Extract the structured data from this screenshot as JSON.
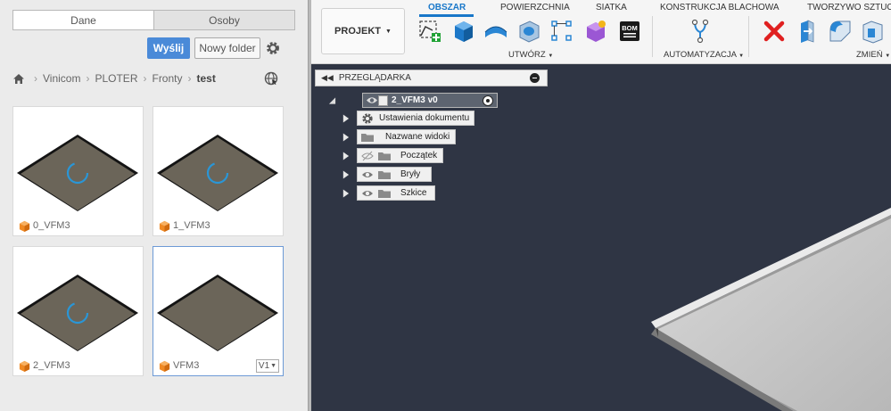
{
  "data_panel": {
    "tabs": [
      {
        "label": "Dane",
        "active": true
      },
      {
        "label": "Osoby",
        "active": false
      }
    ],
    "upload_label": "Wyślij",
    "new_folder_label": "Nowy folder",
    "breadcrumb": [
      "Vinicom",
      "PLOTER",
      "Fronty",
      "test"
    ],
    "cards": [
      {
        "name": "0_VFM3",
        "loading": true
      },
      {
        "name": "1_VFM3",
        "loading": true
      },
      {
        "name": "2_VFM3",
        "loading": true
      },
      {
        "name": "VFM3",
        "loading": false,
        "version": "V1",
        "selected": true
      }
    ]
  },
  "toolbar": {
    "project_label": "PROJEKT",
    "tabs": [
      "OBSZAR",
      "POWIERZCHNIA",
      "SIATKA",
      "KONSTRUKCJA BLACHOWA",
      "TWORZYWO SZTUCZ"
    ],
    "active_tab": "OBSZAR",
    "groups": {
      "create": "UTWÓRZ",
      "automate": "AUTOMATYZACJA",
      "modify": "ZMIEŃ"
    },
    "bom_label": "BOM"
  },
  "browser": {
    "title": "PRZEGLĄDARKA",
    "root_label": "2_VFM3 v0",
    "nodes": [
      {
        "label": "Ustawienia dokumentu",
        "icon": "gear-icon"
      },
      {
        "label": "Nazwane widoki",
        "icon": "folder-icon"
      },
      {
        "label": "Początek",
        "icon": "folder-icon",
        "hidden": true
      },
      {
        "label": "Bryły",
        "icon": "folder-icon"
      },
      {
        "label": "Szkice",
        "icon": "folder-icon"
      }
    ]
  },
  "colors": {
    "accent_blue": "#1877c9",
    "upload_button": "#4a8ad8",
    "viewport_bg": "#2f3544",
    "cube_orange": "#f08a24",
    "delete_red": "#e02020"
  }
}
